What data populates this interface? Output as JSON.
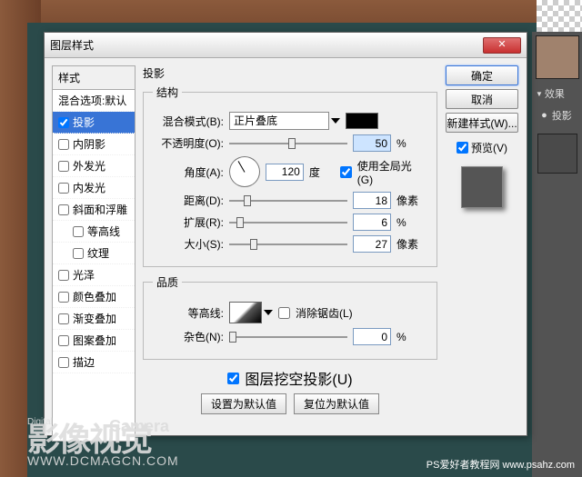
{
  "dialog": {
    "title": "图层样式",
    "styles_header": "样式",
    "styles": [
      {
        "label": "混合选项:默认",
        "checked": null,
        "selected": false
      },
      {
        "label": "投影",
        "checked": true,
        "selected": true
      },
      {
        "label": "内阴影",
        "checked": false,
        "selected": false
      },
      {
        "label": "外发光",
        "checked": false,
        "selected": false
      },
      {
        "label": "内发光",
        "checked": false,
        "selected": false
      },
      {
        "label": "斜面和浮雕",
        "checked": false,
        "selected": false
      },
      {
        "label": "等高线",
        "checked": false,
        "selected": false,
        "indent": true
      },
      {
        "label": "纹理",
        "checked": false,
        "selected": false,
        "indent": true
      },
      {
        "label": "光泽",
        "checked": false,
        "selected": false
      },
      {
        "label": "颜色叠加",
        "checked": false,
        "selected": false
      },
      {
        "label": "渐变叠加",
        "checked": false,
        "selected": false
      },
      {
        "label": "图案叠加",
        "checked": false,
        "selected": false
      },
      {
        "label": "描边",
        "checked": false,
        "selected": false
      }
    ],
    "panel_title": "投影",
    "structure": {
      "legend": "结构",
      "blend_mode_label": "混合模式(B):",
      "blend_mode_value": "正片叠底",
      "color": "#000000",
      "opacity_label": "不透明度(O):",
      "opacity_value": "50",
      "opacity_unit": "%",
      "angle_label": "角度(A):",
      "angle_value": "120",
      "angle_unit": "度",
      "global_light_label": "使用全局光(G)",
      "global_light_checked": true,
      "distance_label": "距离(D):",
      "distance_value": "18",
      "distance_unit": "像素",
      "spread_label": "扩展(R):",
      "spread_value": "6",
      "spread_unit": "%",
      "size_label": "大小(S):",
      "size_value": "27",
      "size_unit": "像素"
    },
    "quality": {
      "legend": "品质",
      "contour_label": "等高线:",
      "antialias_label": "消除锯齿(L)",
      "antialias_checked": false,
      "noise_label": "杂色(N):",
      "noise_value": "0",
      "noise_unit": "%"
    },
    "knockout_label": "图层挖空投影(U)",
    "knockout_checked": true,
    "set_default_btn": "设置为默认值",
    "reset_default_btn": "复位为默认值",
    "buttons": {
      "ok": "确定",
      "cancel": "取消",
      "new_style": "新建样式(W)...",
      "preview_label": "预览(V)",
      "preview_checked": true
    }
  },
  "right_panel": {
    "effect_label": "效果",
    "effect_item": "投影"
  },
  "watermark": {
    "digital": "Digital",
    "camera": "Camera",
    "main": "影像视觉",
    "url": "WWW.DCMAGCN.COM",
    "right": "PS爱好者教程网  www.psahz.com"
  }
}
